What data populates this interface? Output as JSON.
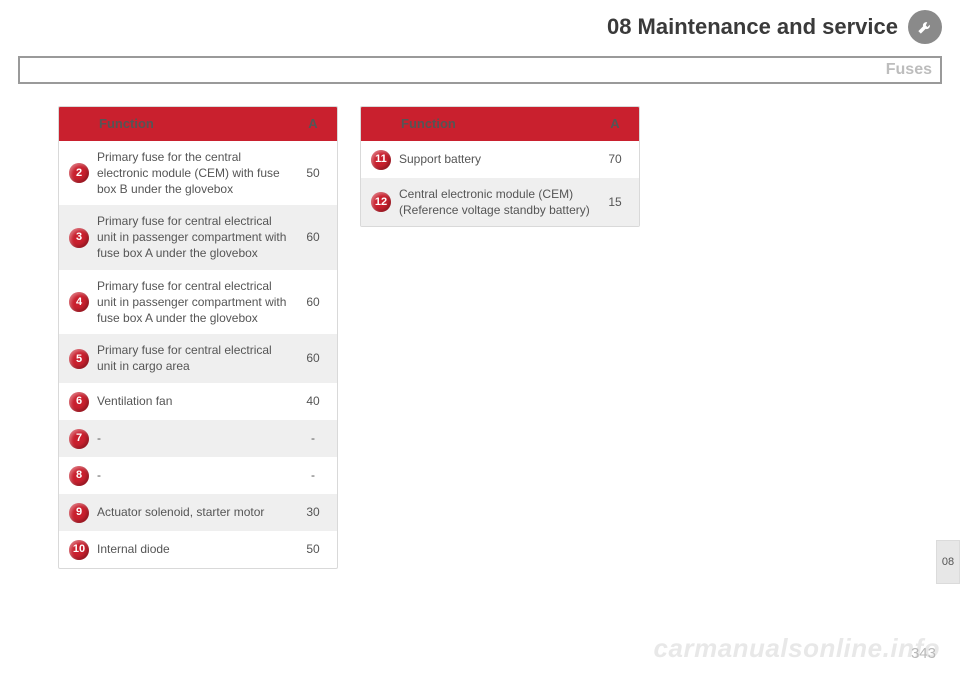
{
  "header": {
    "title": "08 Maintenance and service",
    "subtitle": "Fuses"
  },
  "columns": {
    "function": "Function",
    "amps": "A"
  },
  "table_left": [
    {
      "n": "2",
      "func": "Primary fuse for the central electronic module (CEM) with fuse box B under the glovebox",
      "a": "50",
      "alt": false
    },
    {
      "n": "3",
      "func": "Primary fuse for central electrical unit in passenger compartment with fuse box A under the glovebox",
      "a": "60",
      "alt": true
    },
    {
      "n": "4",
      "func": "Primary fuse for central electrical unit in passenger compartment with fuse box A under the glovebox",
      "a": "60",
      "alt": false
    },
    {
      "n": "5",
      "func": "Primary fuse for central electrical unit in cargo area",
      "a": "60",
      "alt": true
    },
    {
      "n": "6",
      "func": "Ventilation fan",
      "a": "40",
      "alt": false
    },
    {
      "n": "7",
      "func": "-",
      "a": "-",
      "alt": true
    },
    {
      "n": "8",
      "func": "-",
      "a": "-",
      "alt": false
    },
    {
      "n": "9",
      "func": "Actuator solenoid, starter motor",
      "a": "30",
      "alt": true
    },
    {
      "n": "10",
      "func": "Internal diode",
      "a": "50",
      "alt": false
    }
  ],
  "table_right": [
    {
      "n": "11",
      "func": "Support battery",
      "a": "70",
      "alt": false
    },
    {
      "n": "12",
      "func": "Central electronic module (CEM) (Reference voltage standby battery)",
      "a": "15",
      "alt": true
    }
  ],
  "side_tab": "08",
  "page_number": "343",
  "watermark": "carmanualsonline.info"
}
